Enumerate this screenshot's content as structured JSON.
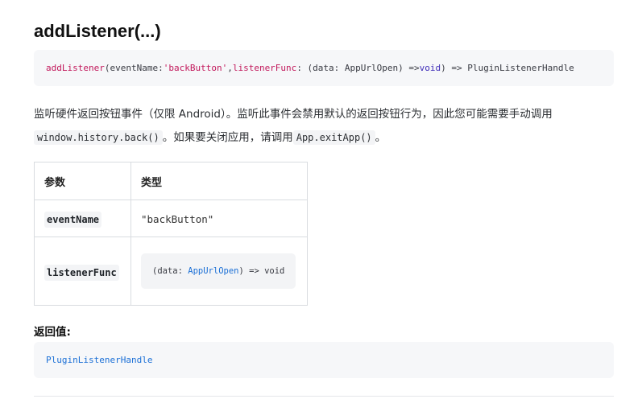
{
  "heading": "addListener(...)",
  "signature": {
    "method": "addListener",
    "p1_open": "(eventName: ",
    "p1_value": "'backButton'",
    "comma": ", ",
    "p2_name": "listenerFunc",
    "p2_type_open": ": (data: AppUrlOpen) => ",
    "void_kw": "void",
    "return_part": ") => PluginListenerHandle"
  },
  "description": {
    "text1": "监听硬件返回按钮事件（仅限 Android）。监听此事件会禁用默认的返回按钮行为，因此您可能需要手动调用",
    "code1": "window.history.back()",
    "text2": "。如果要关闭应用，请调用",
    "code2": "App.exitApp()",
    "text3": "。"
  },
  "table": {
    "headers": [
      "参数",
      "类型"
    ],
    "rows": [
      {
        "param": "eventName",
        "type": "\"backButton\""
      },
      {
        "param": "listenerFunc",
        "type_prefix": "(data: ",
        "type_link": "AppUrlOpen",
        "type_suffix": ") => void"
      }
    ]
  },
  "returns": {
    "title": "返回值:",
    "value": "PluginListenerHandle"
  },
  "colors": {
    "code_bg": "#f6f7f9",
    "keyword": "#3f2db8",
    "string": "#c2185b",
    "type_link": "#1a6fd6"
  }
}
